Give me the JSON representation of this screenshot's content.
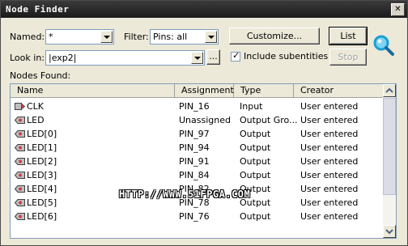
{
  "window": {
    "title": "Node Finder",
    "close_glyph": "✕"
  },
  "named": {
    "label": "Named:",
    "value": "*"
  },
  "filter": {
    "label": "Filter:",
    "value": "Pins: all"
  },
  "look_in": {
    "label": "Look in:",
    "value": "|exp2|",
    "browse_label": "..."
  },
  "buttons": {
    "customize": "Customize...",
    "list": "List",
    "stop": "Stop"
  },
  "include_subentities": {
    "label": "Include subentities",
    "checked": true
  },
  "nodes_found_label": "Nodes Found:",
  "columns": [
    "Name",
    "Assignments",
    "Type",
    "Creator"
  ],
  "rows": [
    {
      "icon": "input-pin-icon",
      "name": "CLK",
      "assignment": "PIN_16",
      "type": "Input",
      "creator": "User entered"
    },
    {
      "icon": "output-pin-icon",
      "name": "LED",
      "assignment": "Unassigned",
      "type": "Output Gro...",
      "creator": "User entered"
    },
    {
      "icon": "output-pin-icon",
      "name": "LED[0]",
      "assignment": "PIN_97",
      "type": "Output",
      "creator": "User entered"
    },
    {
      "icon": "output-pin-icon",
      "name": "LED[1]",
      "assignment": "PIN_94",
      "type": "Output",
      "creator": "User entered"
    },
    {
      "icon": "output-pin-icon",
      "name": "LED[2]",
      "assignment": "PIN_91",
      "type": "Output",
      "creator": "User entered"
    },
    {
      "icon": "output-pin-icon",
      "name": "LED[3]",
      "assignment": "PIN_84",
      "type": "Output",
      "creator": "User entered"
    },
    {
      "icon": "output-pin-icon",
      "name": "LED[4]",
      "assignment": "PIN_82",
      "type": "Output",
      "creator": "User entered"
    },
    {
      "icon": "output-pin-icon",
      "name": "LED[5]",
      "assignment": "PIN_78",
      "type": "Output",
      "creator": "User entered"
    },
    {
      "icon": "output-pin-icon",
      "name": "LED[6]",
      "assignment": "PIN_76",
      "type": "Output",
      "creator": "User entered"
    }
  ],
  "watermark": "HTTP://WWW.51FPGA.COM",
  "colors": {
    "titlebar": "#2a2a2a",
    "dialog_bg": "#ece9d8",
    "border": "#7f9db9",
    "search_lens": "#1a9fd6"
  }
}
